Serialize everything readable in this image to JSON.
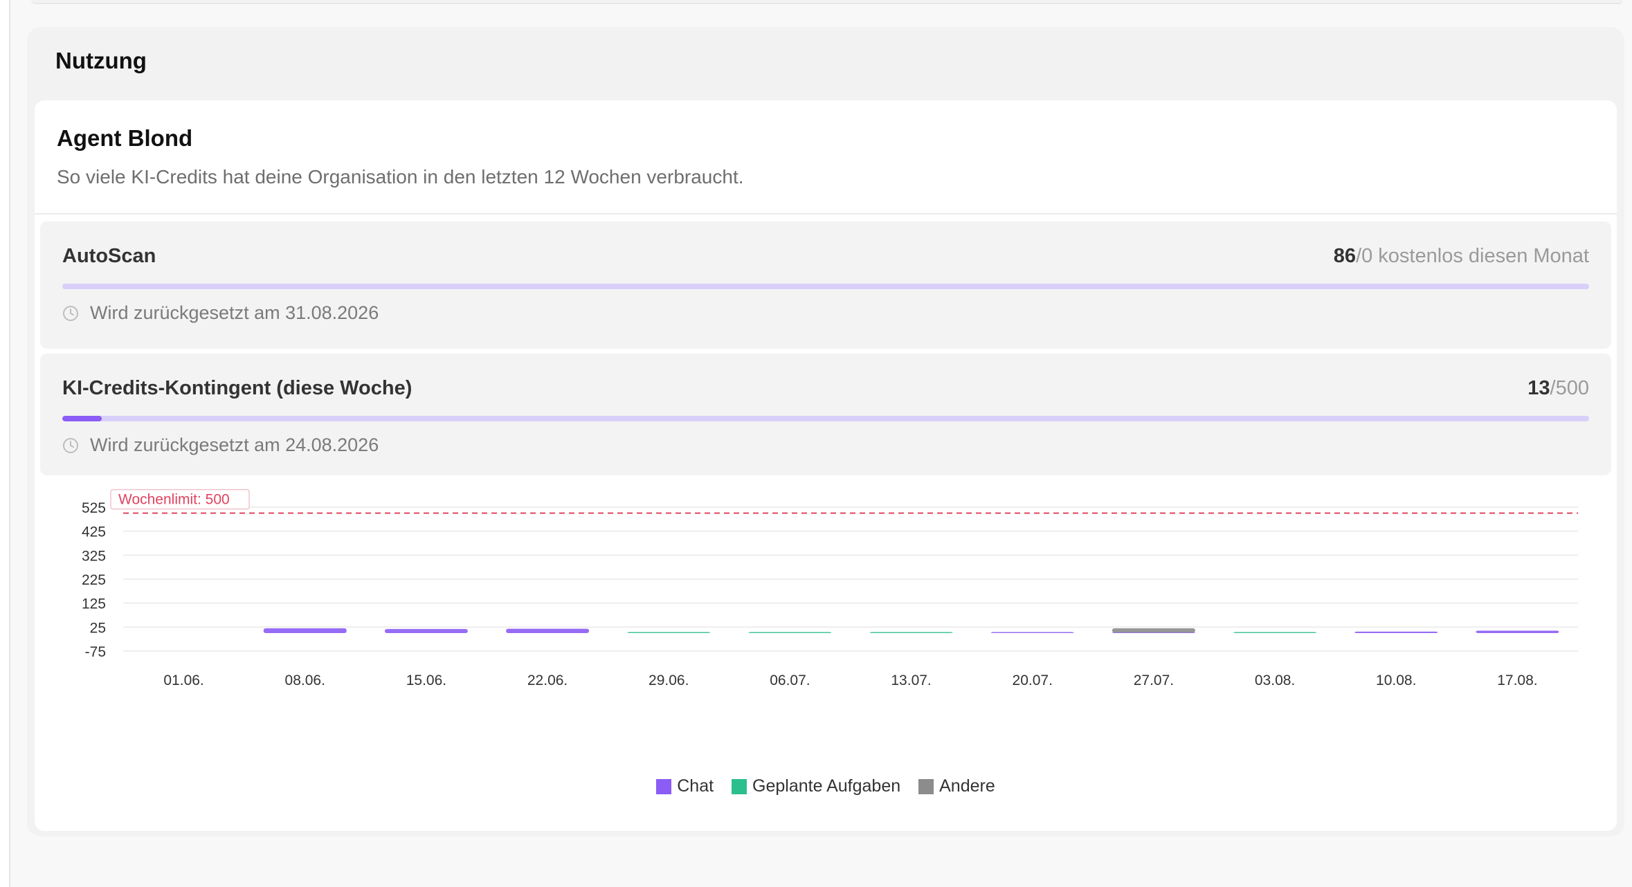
{
  "section": {
    "title": "Nutzung"
  },
  "card": {
    "title": "Agent Blond",
    "subtitle": "So viele KI-Credits hat deine Organisation in den letzten 12 Wochen verbraucht."
  },
  "quotas": [
    {
      "label": "AutoScan",
      "used": "86",
      "rest": "/0 kostenlos diesen Monat",
      "progress_fraction": 1.0,
      "reset": "Wird zurückgesetzt am 31.08.2026"
    },
    {
      "label": "KI-Credits-Kontingent (diese Woche)",
      "used": "13",
      "rest": "/500",
      "progress_fraction": 0.026,
      "reset": "Wird zurückgesetzt am 24.08.2026"
    }
  ],
  "colors": {
    "chat": "#8b5cf6",
    "geplante": "#2bbf8e",
    "andere": "#8c8c8c",
    "limit": "#e0445f",
    "progress_track": "#d9cffb"
  },
  "icons": {
    "reset": "clock-icon"
  },
  "chart_data": {
    "type": "bar",
    "stacked": true,
    "categories": [
      "01.06.",
      "08.06.",
      "15.06.",
      "22.06.",
      "29.06.",
      "06.07.",
      "13.07.",
      "20.07.",
      "27.07.",
      "03.08.",
      "10.08.",
      "17.08."
    ],
    "series": [
      {
        "name": "Chat",
        "values": [
          0,
          20,
          17,
          18,
          0,
          0,
          0,
          4,
          2,
          0,
          6,
          10
        ]
      },
      {
        "name": "Geplante Aufgaben",
        "values": [
          0,
          0,
          0,
          0,
          2,
          2,
          2,
          0,
          0,
          0.5,
          0,
          0
        ]
      },
      {
        "name": "Andere",
        "values": [
          0,
          0,
          0,
          0,
          0,
          0,
          0,
          0,
          18,
          0,
          0,
          0
        ]
      }
    ],
    "yticks": [
      525,
      425,
      325,
      225,
      125,
      25,
      -75
    ],
    "ylim": [
      -75,
      525
    ],
    "limit_line": {
      "value": 500,
      "label": "Wochenlimit: 500"
    },
    "grid": true,
    "legend": "bottom-center"
  }
}
